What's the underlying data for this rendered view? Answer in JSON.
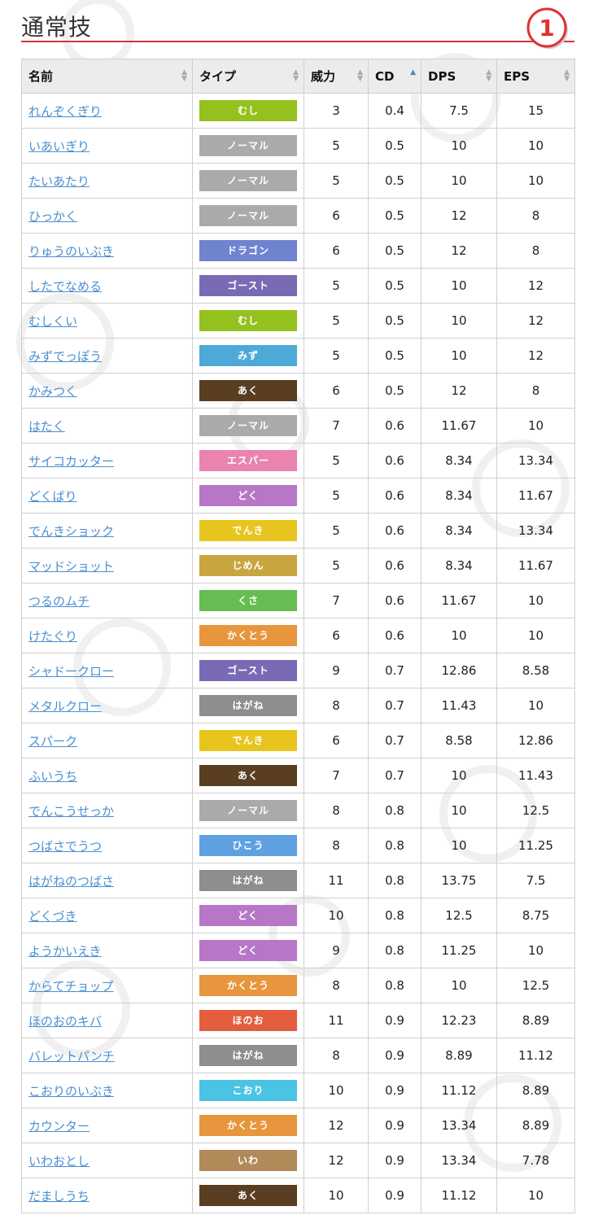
{
  "section": {
    "title": "通常技",
    "number_badge": "1"
  },
  "colors": {
    "むし": "#95c11f",
    "ノーマル": "#aaaaaa",
    "ドラゴン": "#6f83cf",
    "ゴースト": "#7a6ab5",
    "みず": "#4da9d8",
    "あく": "#5a3e22",
    "エスパー": "#ea83b0",
    "どく": "#b777c6",
    "でんき": "#e7c51e",
    "じめん": "#c8a53f",
    "くさ": "#67bd52",
    "かくとう": "#e7963e",
    "はがね": "#8e8e8e",
    "ひこう": "#5fa1e0",
    "ほのお": "#e25e3f",
    "こおり": "#4bc3e4",
    "いわ": "#b08a58",
    "accent": "#dd3333",
    "link": "#4a8fd0"
  },
  "table": {
    "headers": [
      "名前",
      "タイプ",
      "威力",
      "CD",
      "DPS",
      "EPS"
    ],
    "sorted_column": "CD",
    "rows": [
      {
        "name": "れんぞくぎり",
        "type": "むし",
        "power": "3",
        "cd": "0.4",
        "dps": "7.5",
        "eps": "15"
      },
      {
        "name": "いあいぎり",
        "type": "ノーマル",
        "power": "5",
        "cd": "0.5",
        "dps": "10",
        "eps": "10"
      },
      {
        "name": "たいあたり",
        "type": "ノーマル",
        "power": "5",
        "cd": "0.5",
        "dps": "10",
        "eps": "10"
      },
      {
        "name": "ひっかく",
        "type": "ノーマル",
        "power": "6",
        "cd": "0.5",
        "dps": "12",
        "eps": "8"
      },
      {
        "name": "りゅうのいぶき",
        "type": "ドラゴン",
        "power": "6",
        "cd": "0.5",
        "dps": "12",
        "eps": "8"
      },
      {
        "name": "したでなめる",
        "type": "ゴースト",
        "power": "5",
        "cd": "0.5",
        "dps": "10",
        "eps": "12"
      },
      {
        "name": "むしくい",
        "type": "むし",
        "power": "5",
        "cd": "0.5",
        "dps": "10",
        "eps": "12"
      },
      {
        "name": "みずでっぽう",
        "type": "みず",
        "power": "5",
        "cd": "0.5",
        "dps": "10",
        "eps": "12"
      },
      {
        "name": "かみつく",
        "type": "あく",
        "power": "6",
        "cd": "0.5",
        "dps": "12",
        "eps": "8"
      },
      {
        "name": "はたく",
        "type": "ノーマル",
        "power": "7",
        "cd": "0.6",
        "dps": "11.67",
        "eps": "10"
      },
      {
        "name": "サイコカッター",
        "type": "エスパー",
        "power": "5",
        "cd": "0.6",
        "dps": "8.34",
        "eps": "13.34"
      },
      {
        "name": "どくばり",
        "type": "どく",
        "power": "5",
        "cd": "0.6",
        "dps": "8.34",
        "eps": "11.67"
      },
      {
        "name": "でんきショック",
        "type": "でんき",
        "power": "5",
        "cd": "0.6",
        "dps": "8.34",
        "eps": "13.34"
      },
      {
        "name": "マッドショット",
        "type": "じめん",
        "power": "5",
        "cd": "0.6",
        "dps": "8.34",
        "eps": "11.67"
      },
      {
        "name": "つるのムチ",
        "type": "くさ",
        "power": "7",
        "cd": "0.6",
        "dps": "11.67",
        "eps": "10"
      },
      {
        "name": "けたぐり",
        "type": "かくとう",
        "power": "6",
        "cd": "0.6",
        "dps": "10",
        "eps": "10"
      },
      {
        "name": "シャドークロー",
        "type": "ゴースト",
        "power": "9",
        "cd": "0.7",
        "dps": "12.86",
        "eps": "8.58"
      },
      {
        "name": "メタルクロー",
        "type": "はがね",
        "power": "8",
        "cd": "0.7",
        "dps": "11.43",
        "eps": "10"
      },
      {
        "name": "スパーク",
        "type": "でんき",
        "power": "6",
        "cd": "0.7",
        "dps": "8.58",
        "eps": "12.86"
      },
      {
        "name": "ふいうち",
        "type": "あく",
        "power": "7",
        "cd": "0.7",
        "dps": "10",
        "eps": "11.43"
      },
      {
        "name": "でんこうせっか",
        "type": "ノーマル",
        "power": "8",
        "cd": "0.8",
        "dps": "10",
        "eps": "12.5"
      },
      {
        "name": "つばさでうつ",
        "type": "ひこう",
        "power": "8",
        "cd": "0.8",
        "dps": "10",
        "eps": "11.25"
      },
      {
        "name": "はがねのつばさ",
        "type": "はがね",
        "power": "11",
        "cd": "0.8",
        "dps": "13.75",
        "eps": "7.5"
      },
      {
        "name": "どくづき",
        "type": "どく",
        "power": "10",
        "cd": "0.8",
        "dps": "12.5",
        "eps": "8.75"
      },
      {
        "name": "ようかいえき",
        "type": "どく",
        "power": "9",
        "cd": "0.8",
        "dps": "11.25",
        "eps": "10"
      },
      {
        "name": "からてチョップ",
        "type": "かくとう",
        "power": "8",
        "cd": "0.8",
        "dps": "10",
        "eps": "12.5"
      },
      {
        "name": "ほのおのキバ",
        "type": "ほのお",
        "power": "11",
        "cd": "0.9",
        "dps": "12.23",
        "eps": "8.89"
      },
      {
        "name": "バレットパンチ",
        "type": "はがね",
        "power": "8",
        "cd": "0.9",
        "dps": "8.89",
        "eps": "11.12"
      },
      {
        "name": "こおりのいぶき",
        "type": "こおり",
        "power": "10",
        "cd": "0.9",
        "dps": "11.12",
        "eps": "8.89"
      },
      {
        "name": "カウンター",
        "type": "かくとう",
        "power": "12",
        "cd": "0.9",
        "dps": "13.34",
        "eps": "8.89"
      },
      {
        "name": "いわおとし",
        "type": "いわ",
        "power": "12",
        "cd": "0.9",
        "dps": "13.34",
        "eps": "7.78"
      },
      {
        "name": "だましうち",
        "type": "あく",
        "power": "10",
        "cd": "0.9",
        "dps": "11.12",
        "eps": "10"
      }
    ]
  }
}
